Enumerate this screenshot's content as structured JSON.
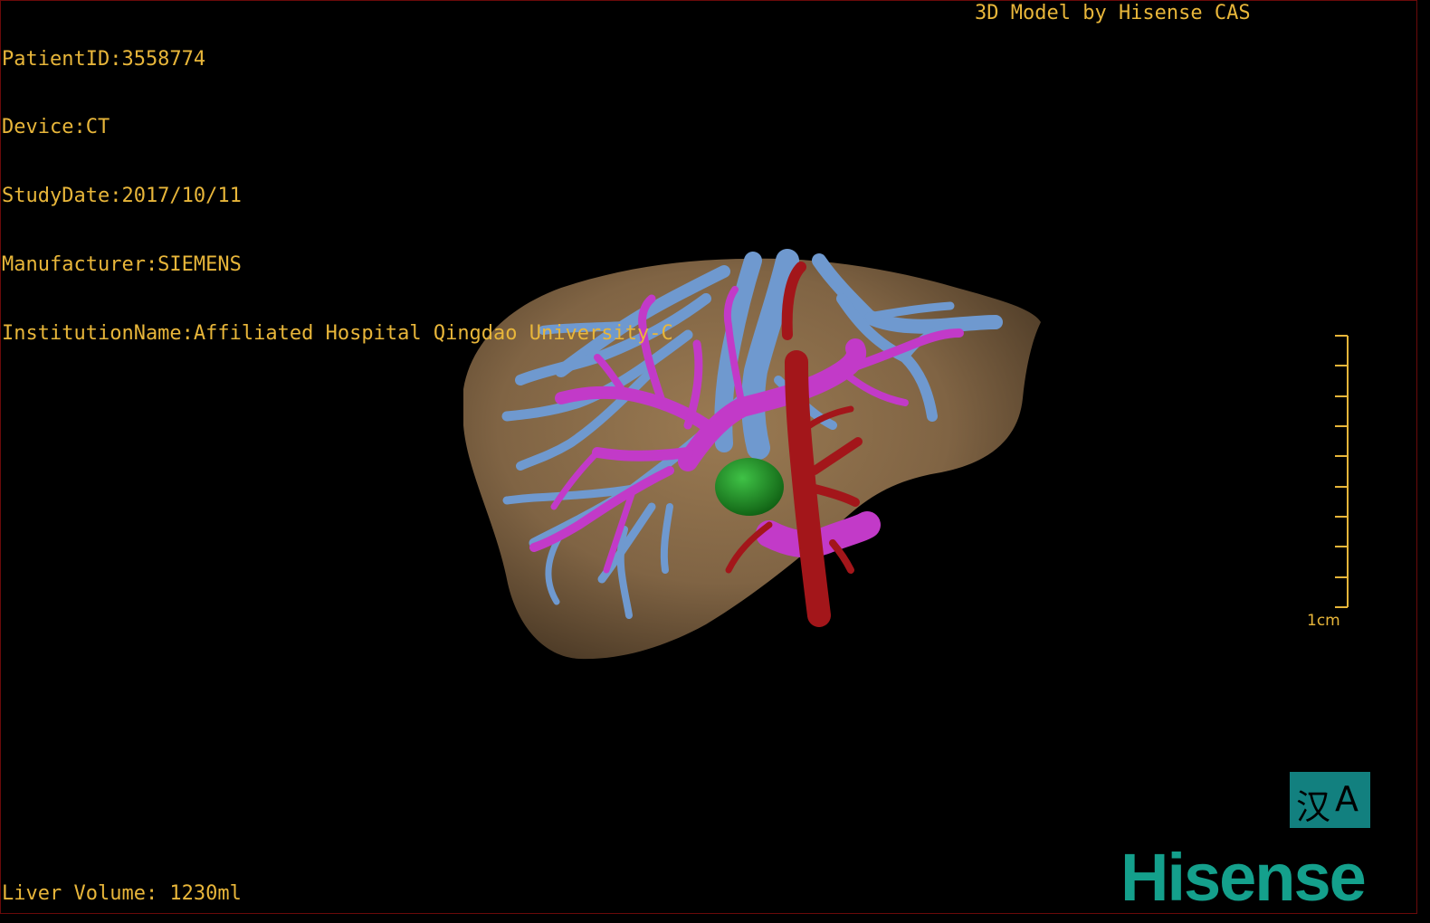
{
  "overlay": {
    "patient_id": "PatientID:3558774",
    "device": "Device:CT",
    "study_date": "StudyDate:2017/10/11",
    "manufacturer": "Manufacturer:SIEMENS",
    "institution": "InstitutionName:Affiliated Hospital Qingdao University-C",
    "model_credit": "3D Model by Hisense CAS",
    "liver_volume": "Liver Volume: 1230ml"
  },
  "scale_bar": {
    "label": "1cm",
    "ticks": 10
  },
  "logo": {
    "glyph_left": "汉",
    "glyph_right": "A",
    "brand": "Hisense"
  },
  "colors": {
    "text": "#e8b63a",
    "liver": "#8a6c48",
    "hepatic_vein": "#6f99cf",
    "portal_vein": "#c23ac8",
    "artery": "#a3161a",
    "tumor": "#1f9a26",
    "brand": "#14a08c"
  }
}
